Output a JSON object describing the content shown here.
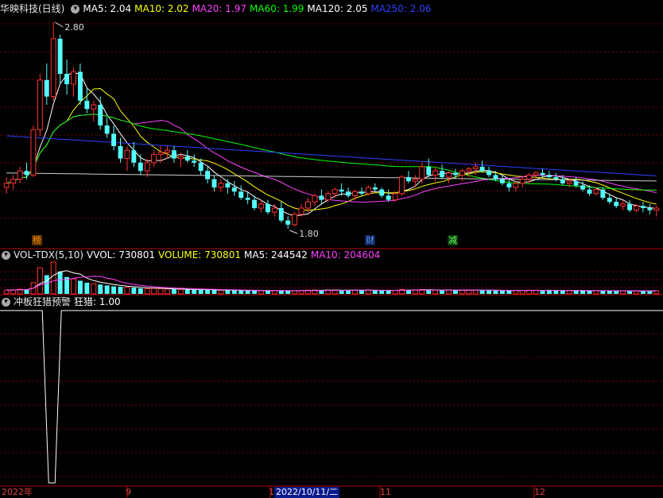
{
  "main_legend": {
    "title": "华映科技(日线)",
    "items": [
      {
        "label": "MA5: 2.04",
        "color": "#ffffff"
      },
      {
        "label": "MA10: 2.02",
        "color": "#ffff00"
      },
      {
        "label": "MA20: 1.97",
        "color": "#ff40ff"
      },
      {
        "label": "MA60: 1.99",
        "color": "#00ff00"
      },
      {
        "label": "MA120: 2.05",
        "color": "#ffffff"
      },
      {
        "label": "MA250: 2.06",
        "color": "#3040ff"
      }
    ]
  },
  "vol_legend": {
    "title": "VOL-TDX(5,10)",
    "items": [
      {
        "label": "VVOL: 730801",
        "color": "#ffffff"
      },
      {
        "label": "VOLUME: 730801",
        "color": "#ffff00"
      },
      {
        "label": "MA5: 244542",
        "color": "#ffffff"
      },
      {
        "label": "MA10: 204604",
        "color": "#ff40ff"
      }
    ]
  },
  "ind_legend": {
    "title": "冲板狂猎预警",
    "items": [
      {
        "label": "狂猎: 1.00",
        "color": "#ffffff"
      }
    ]
  },
  "price_high_label": "2.80",
  "price_low_label": "1.80",
  "event_marks": [
    {
      "text": "榜",
      "color": "#ff8c00",
      "bg": "#5a3200"
    },
    {
      "text": "财",
      "color": "#5599ff",
      "bg": "#102050"
    },
    {
      "text": "减",
      "color": "#66ff66",
      "bg": "#0a3a0a"
    }
  ],
  "x_axis": {
    "labels": [
      "2022年",
      "9",
      "1",
      "11",
      "12"
    ],
    "cursor_date": "2022/10/11/二"
  },
  "colors": {
    "up": "#ff3232",
    "down": "#54ffff",
    "grid": "#800000",
    "ma5": "#ffffff",
    "ma10": "#ffff00",
    "ma20": "#ff40ff",
    "ma60": "#00ff00",
    "ma120": "#d0d0d0",
    "ma250": "#3040ff"
  },
  "chart_data": {
    "type": "candlestick",
    "security": "华映科技(日线)",
    "price_range": [
      1.8,
      2.8
    ],
    "candles_ohlc": [
      [
        2.0,
        2.05,
        1.97,
        2.02
      ],
      [
        2.02,
        2.06,
        1.99,
        2.04
      ],
      [
        2.04,
        2.1,
        2.02,
        2.08
      ],
      [
        2.08,
        2.12,
        2.04,
        2.06
      ],
      [
        2.06,
        2.3,
        2.05,
        2.28
      ],
      [
        2.28,
        2.55,
        2.25,
        2.52
      ],
      [
        2.52,
        2.6,
        2.4,
        2.44
      ],
      [
        2.44,
        2.8,
        2.42,
        2.72
      ],
      [
        2.72,
        2.74,
        2.5,
        2.55
      ],
      [
        2.55,
        2.62,
        2.45,
        2.5
      ],
      [
        2.5,
        2.58,
        2.44,
        2.56
      ],
      [
        2.56,
        2.6,
        2.4,
        2.42
      ],
      [
        2.42,
        2.48,
        2.36,
        2.38
      ],
      [
        2.38,
        2.42,
        2.32,
        2.4
      ],
      [
        2.4,
        2.44,
        2.28,
        2.3
      ],
      [
        2.3,
        2.34,
        2.24,
        2.26
      ],
      [
        2.26,
        2.3,
        2.18,
        2.2
      ],
      [
        2.2,
        2.24,
        2.12,
        2.14
      ],
      [
        2.14,
        2.2,
        2.08,
        2.18
      ],
      [
        2.18,
        2.22,
        2.1,
        2.12
      ],
      [
        2.12,
        2.16,
        2.06,
        2.08
      ],
      [
        2.08,
        2.14,
        2.05,
        2.12
      ],
      [
        2.12,
        2.18,
        2.1,
        2.16
      ],
      [
        2.16,
        2.2,
        2.12,
        2.17
      ],
      [
        2.17,
        2.2,
        2.14,
        2.18
      ],
      [
        2.18,
        2.2,
        2.12,
        2.14
      ],
      [
        2.14,
        2.17,
        2.1,
        2.15
      ],
      [
        2.15,
        2.18,
        2.12,
        2.13
      ],
      [
        2.13,
        2.16,
        2.1,
        2.12
      ],
      [
        2.12,
        2.14,
        2.06,
        2.08
      ],
      [
        2.08,
        2.1,
        2.02,
        2.04
      ],
      [
        2.04,
        2.06,
        1.98,
        2.0
      ],
      [
        2.0,
        2.04,
        1.98,
        2.02
      ],
      [
        2.02,
        2.04,
        1.97,
        2.0
      ],
      [
        2.0,
        2.03,
        1.96,
        1.98
      ],
      [
        1.98,
        2.01,
        1.94,
        1.95
      ],
      [
        1.95,
        1.98,
        1.92,
        1.94
      ],
      [
        1.94,
        1.96,
        1.89,
        1.9
      ],
      [
        1.9,
        1.94,
        1.88,
        1.92
      ],
      [
        1.92,
        1.94,
        1.87,
        1.88
      ],
      [
        1.88,
        1.92,
        1.86,
        1.9
      ],
      [
        1.9,
        1.93,
        1.83,
        1.84
      ],
      [
        1.84,
        1.86,
        1.8,
        1.82
      ],
      [
        1.82,
        1.88,
        1.81,
        1.87
      ],
      [
        1.87,
        1.92,
        1.86,
        1.9
      ],
      [
        1.9,
        1.95,
        1.88,
        1.93
      ],
      [
        1.93,
        1.97,
        1.91,
        1.96
      ],
      [
        1.96,
        1.99,
        1.92,
        1.94
      ],
      [
        1.94,
        1.98,
        1.93,
        1.97
      ],
      [
        1.97,
        2.0,
        1.95,
        1.99
      ],
      [
        1.99,
        2.02,
        1.96,
        1.98
      ],
      [
        1.98,
        2.0,
        1.95,
        1.96
      ],
      [
        1.96,
        1.99,
        1.94,
        1.98
      ],
      [
        1.98,
        2.0,
        1.96,
        1.97
      ],
      [
        1.97,
        2.01,
        1.96,
        2.0
      ],
      [
        2.0,
        2.02,
        1.98,
        1.99
      ],
      [
        1.99,
        2.0,
        1.95,
        1.96
      ],
      [
        1.96,
        1.99,
        1.93,
        1.94
      ],
      [
        1.94,
        1.98,
        1.93,
        1.97
      ],
      [
        1.97,
        2.06,
        1.96,
        2.05
      ],
      [
        2.05,
        2.08,
        2.02,
        2.03
      ],
      [
        2.03,
        2.06,
        2.0,
        2.04
      ],
      [
        2.04,
        2.12,
        2.02,
        2.1
      ],
      [
        2.1,
        2.14,
        2.05,
        2.06
      ],
      [
        2.06,
        2.1,
        2.03,
        2.08
      ],
      [
        2.08,
        2.11,
        2.04,
        2.05
      ],
      [
        2.05,
        2.08,
        2.02,
        2.07
      ],
      [
        2.07,
        2.09,
        2.04,
        2.06
      ],
      [
        2.06,
        2.09,
        2.03,
        2.08
      ],
      [
        2.08,
        2.1,
        2.05,
        2.09
      ],
      [
        2.09,
        2.12,
        2.06,
        2.1
      ],
      [
        2.1,
        2.13,
        2.07,
        2.08
      ],
      [
        2.08,
        2.1,
        2.05,
        2.06
      ],
      [
        2.06,
        2.08,
        2.03,
        2.04
      ],
      [
        2.04,
        2.06,
        2.01,
        2.02
      ],
      [
        2.02,
        2.04,
        1.98,
        2.0
      ],
      [
        2.0,
        2.03,
        1.98,
        2.02
      ],
      [
        2.02,
        2.05,
        2.0,
        2.04
      ],
      [
        2.04,
        2.07,
        2.02,
        2.06
      ],
      [
        2.06,
        2.08,
        2.04,
        2.07
      ],
      [
        2.07,
        2.09,
        2.05,
        2.06
      ],
      [
        2.06,
        2.08,
        2.04,
        2.05
      ],
      [
        2.05,
        2.07,
        2.03,
        2.04
      ],
      [
        2.04,
        2.06,
        2.01,
        2.02
      ],
      [
        2.02,
        2.04,
        2.0,
        2.03
      ],
      [
        2.03,
        2.05,
        2.0,
        2.01
      ],
      [
        2.01,
        2.03,
        1.98,
        1.99
      ],
      [
        1.99,
        2.01,
        1.96,
        1.97
      ],
      [
        1.97,
        2.0,
        1.96,
        1.99
      ],
      [
        1.99,
        2.0,
        1.94,
        1.95
      ],
      [
        1.95,
        1.97,
        1.92,
        1.93
      ],
      [
        1.93,
        1.95,
        1.9,
        1.91
      ],
      [
        1.91,
        1.94,
        1.89,
        1.92
      ],
      [
        1.92,
        1.94,
        1.88,
        1.89
      ],
      [
        1.89,
        1.92,
        1.88,
        1.91
      ],
      [
        1.91,
        1.93,
        1.88,
        1.9
      ],
      [
        1.9,
        1.92,
        1.87,
        1.89
      ],
      [
        1.89,
        1.91,
        1.86,
        1.9
      ]
    ],
    "volume": [
      20,
      22,
      25,
      24,
      60,
      140,
      100,
      170,
      120,
      90,
      80,
      70,
      60,
      55,
      50,
      45,
      40,
      38,
      36,
      34,
      30,
      28,
      30,
      28,
      26,
      25,
      24,
      23,
      22,
      22,
      21,
      20,
      20,
      19,
      19,
      18,
      18,
      17,
      18,
      17,
      17,
      18,
      16,
      18,
      19,
      20,
      21,
      19,
      20,
      21,
      20,
      19,
      20,
      19,
      20,
      19,
      18,
      18,
      19,
      24,
      22,
      21,
      23,
      21,
      20,
      19,
      20,
      19,
      20,
      21,
      21,
      20,
      19,
      18,
      18,
      17,
      18,
      19,
      20,
      20,
      19,
      19,
      18,
      18,
      18,
      17,
      17,
      16,
      17,
      17,
      16,
      16,
      17,
      16,
      16,
      16,
      16,
      17
    ],
    "indicator_value": 1.0,
    "indicator_dip_index": 7
  }
}
